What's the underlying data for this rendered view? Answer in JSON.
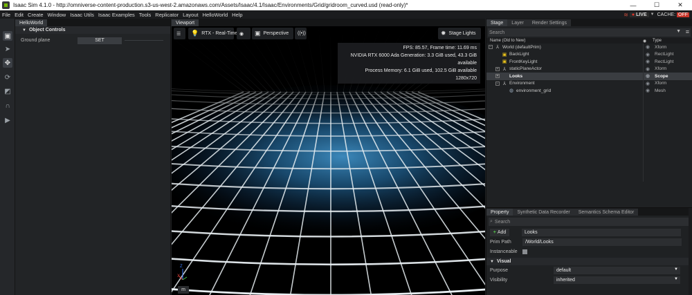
{
  "window": {
    "title": "Isaac Sim 4.1.0 - http://omniverse-content-production.s3-us-west-2.amazonaws.com/Assets/Isaac/4.1/Isaac/Environments/Grid/gridroom_curved.usd (read-only)*",
    "minimize": "—",
    "maximize": "☐",
    "close": "✕"
  },
  "menu": {
    "items": [
      "File",
      "Edit",
      "Create",
      "Window",
      "Isaac Utils",
      "Isaac Examples",
      "Tools",
      "Replicator",
      "Layout",
      "HelloWorld",
      "Help"
    ],
    "live_label": "LIVE",
    "cache_label": "CACHE:",
    "cache_state": "OFF"
  },
  "hello_world": {
    "tab": "HelloWorld",
    "section_title": "Object Controls",
    "ground_plane_label": "Ground plane",
    "set_button": "SET"
  },
  "viewport": {
    "tab": "Viewport",
    "render_mode": "RTX - Real-Time",
    "camera": "Perspective",
    "stage_lights": "Stage Lights",
    "stats": [
      "FPS: 85.57, Frame time: 11.69 ms",
      "NVIDIA RTX 6000 Ada Generation: 3.3 GiB used, 43.3 GiB available",
      "Process Memory: 6.1 GiB used, 102.5 GiB available",
      "1280x720"
    ],
    "axis_z": "Z",
    "axis_x": "X",
    "units_button": "m"
  },
  "stage": {
    "tabs": [
      "Stage",
      "Layer",
      "Render Settings"
    ],
    "search_placeholder": "Search",
    "col_name": "Name (Old to New)",
    "col_type": "Type",
    "rows": [
      {
        "name": "World (defaultPrim)",
        "type": "Xform"
      },
      {
        "name": "BackLight",
        "type": "RectLight"
      },
      {
        "name": "FrontKeyLight",
        "type": "RectLight"
      },
      {
        "name": "staticPlaneActor",
        "type": "Xform"
      },
      {
        "name": "Looks",
        "type": "Scope"
      },
      {
        "name": "Environment",
        "type": "Xform"
      },
      {
        "name": "environment_grid",
        "type": "Mesh"
      }
    ]
  },
  "property": {
    "tabs": [
      "Property",
      "Synthetic Data Recorder",
      "Semantics Schema Editor"
    ],
    "search_placeholder": "Search",
    "add_label": "Add",
    "prim_name": "Looks",
    "prim_path_label": "Prim Path",
    "prim_path": "/World/Looks",
    "instanceable_label": "Instanceable",
    "visual_section": "Visual",
    "purpose_label": "Purpose",
    "purpose_value": "default",
    "visibility_label": "Visibility",
    "visibility_value": "inherited"
  },
  "colors": {
    "accent_green": "#76b900",
    "live_red": "#e2342a",
    "light_icon": "#e9c21a"
  }
}
